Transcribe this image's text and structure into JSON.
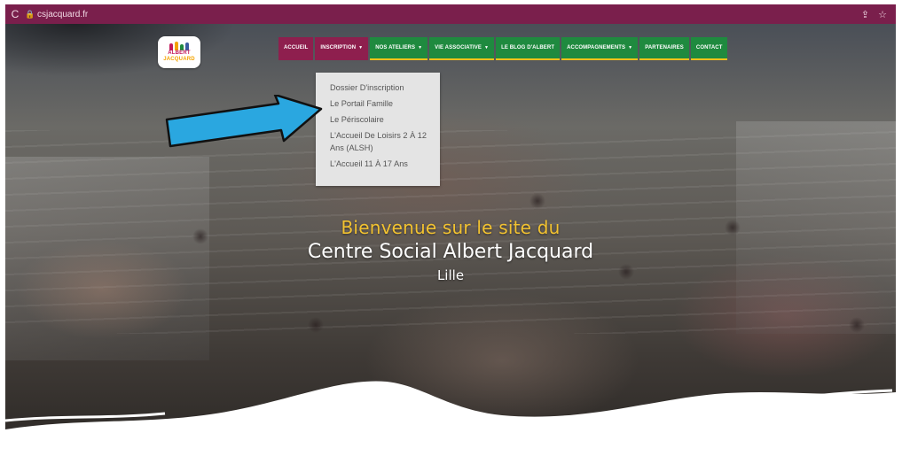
{
  "browser": {
    "url": "csjacquard.fr",
    "reload_icon": "reload-icon",
    "lock_icon": "lock-icon",
    "share_icon": "share-icon",
    "bookmark_icon": "star-icon"
  },
  "logo": {
    "line1": "ALBERT",
    "line2": "JACQUARD"
  },
  "nav": {
    "items": [
      {
        "label": "ACCUEIL"
      },
      {
        "label": "INSCRIPTION",
        "caret": "▼"
      },
      {
        "label": "NOS ATELIERS",
        "caret": "▼"
      },
      {
        "label": "VIE ASSOCIATIVE",
        "caret": "▼"
      },
      {
        "label": "LE BLOG D'ALBERT"
      },
      {
        "label": "ACCOMPAGNEMENTS",
        "caret": "▼"
      },
      {
        "label": "PARTENAIRES"
      },
      {
        "label": "CONTACT"
      }
    ]
  },
  "dropdown": {
    "items": [
      "Dossier D'inscription",
      "Le Portail Famille",
      "Le Périscolaire",
      "L'Accueil De Loisirs 2 À 12 Ans (ALSH)",
      "L'Accueil 11 À 17 Ans"
    ]
  },
  "hero": {
    "line1": "Bienvenue sur le site du",
    "line2": "Centre Social Albert Jacquard",
    "line3": "Lille"
  },
  "colors": {
    "browser_bar": "#7a1f4c",
    "nav_green": "#1f8a3f",
    "nav_active": "#8e1f4e",
    "nav_underline": "#f4c21a",
    "welcome_yellow": "#f2c230",
    "arrow_blue": "#2aa7e0"
  }
}
